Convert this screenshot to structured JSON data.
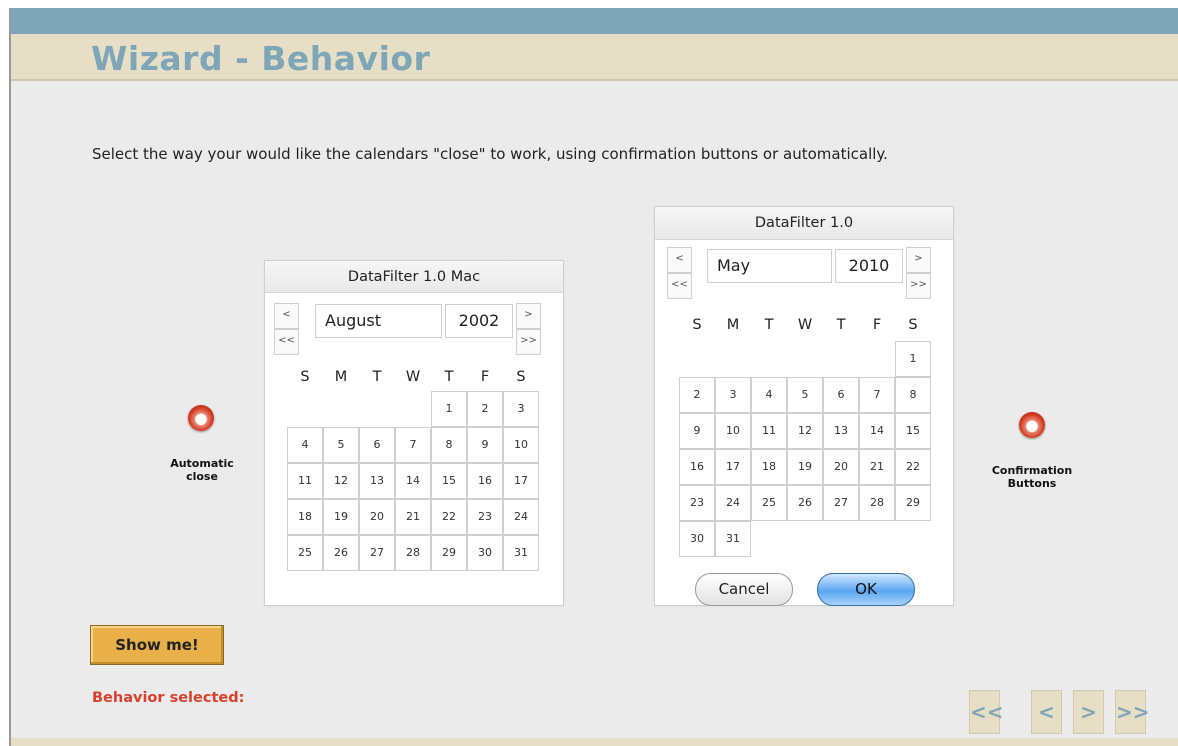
{
  "header": {
    "title": "Wizard - Behavior"
  },
  "instructions": "Select the way your would like the calendars \"close\" to work, using confirmation buttons or automatically.",
  "calendar_auto": {
    "title": "DataFilter 1.0 Mac",
    "month": "August",
    "year": "2002",
    "nav": {
      "prev": "<",
      "prev_year": "<<",
      "next": ">",
      "next_year": ">>"
    },
    "weekdays": [
      "S",
      "M",
      "T",
      "W",
      "T",
      "F",
      "S"
    ],
    "days": [
      "1",
      "2",
      "3",
      "4",
      "5",
      "6",
      "7",
      "8",
      "9",
      "10",
      "11",
      "12",
      "13",
      "14",
      "15",
      "16",
      "17",
      "18",
      "19",
      "20",
      "21",
      "22",
      "23",
      "24",
      "25",
      "26",
      "27",
      "28",
      "29",
      "30",
      "31"
    ]
  },
  "calendar_confirm": {
    "title": "DataFilter 1.0",
    "month": "May",
    "year": "2010",
    "nav": {
      "prev": "<",
      "prev_year": "<<",
      "next": ">",
      "next_year": ">>"
    },
    "weekdays": [
      "S",
      "M",
      "T",
      "W",
      "T",
      "F",
      "S"
    ],
    "days": [
      "1",
      "2",
      "3",
      "4",
      "5",
      "6",
      "7",
      "8",
      "9",
      "10",
      "11",
      "12",
      "13",
      "14",
      "15",
      "16",
      "17",
      "18",
      "19",
      "20",
      "21",
      "22",
      "23",
      "24",
      "25",
      "26",
      "27",
      "28",
      "29",
      "30",
      "31"
    ],
    "cancel_label": "Cancel",
    "ok_label": "OK"
  },
  "options": {
    "automatic": {
      "line1": "Automatic",
      "line2": "close"
    },
    "confirmation": {
      "line1": "Confirmation",
      "line2": "Buttons"
    }
  },
  "show_me_label": "Show me!",
  "behavior_selected_label": "Behavior selected:",
  "wizard_nav": {
    "first": "<<",
    "prev": "<",
    "next": ">",
    "last": ">>"
  },
  "colors": {
    "accent": "#7fa6b8",
    "title_band": "#e6dfc6",
    "alert": "#d9402b",
    "button": "#e9b04a"
  }
}
